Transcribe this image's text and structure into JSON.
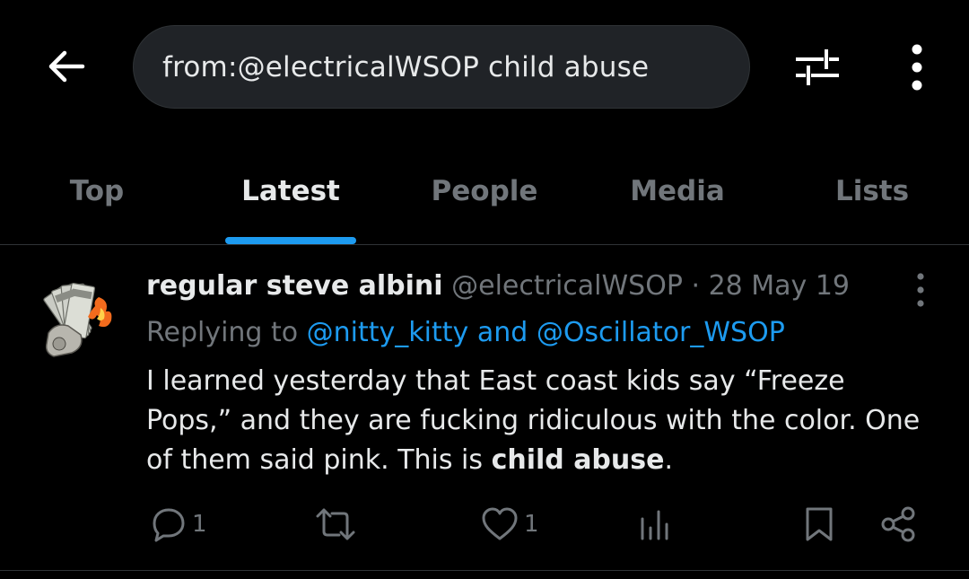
{
  "header": {
    "search_query": "from:@electricalWSOP child abuse",
    "back_icon": "arrow-left-icon",
    "filter_icon": "sliders-icon",
    "more_icon": "more-vertical-icon"
  },
  "tabs": [
    {
      "label": "Top",
      "active": false
    },
    {
      "label": "Latest",
      "active": true
    },
    {
      "label": "People",
      "active": false
    },
    {
      "label": "Media",
      "active": false
    },
    {
      "label": "Lists",
      "active": false
    }
  ],
  "tweet": {
    "display_name": "regular steve albini",
    "handle": "@electricalWSOP",
    "separator": "·",
    "date": "28 May 19",
    "replying_prefix": "Replying to ",
    "reply_to_1": "@nitty_kitty",
    "reply_and": " and ",
    "reply_to_2": "@Oscillator_WSOP",
    "text_part1": "I learned yesterday that East coast kids say “Freeze Pops,” and they are fucking ridiculous with the color. One of them said pink. This is ",
    "text_bold": "child abuse",
    "text_part2": ".",
    "actions": {
      "reply_count": "1",
      "retweet_count": "",
      "like_count": "1"
    }
  },
  "colors": {
    "background": "#000000",
    "accent": "#1d9bf0",
    "text_primary": "#e7e9ea",
    "text_secondary": "#71767b",
    "divider": "#2f3336",
    "search_bg": "#202327"
  }
}
